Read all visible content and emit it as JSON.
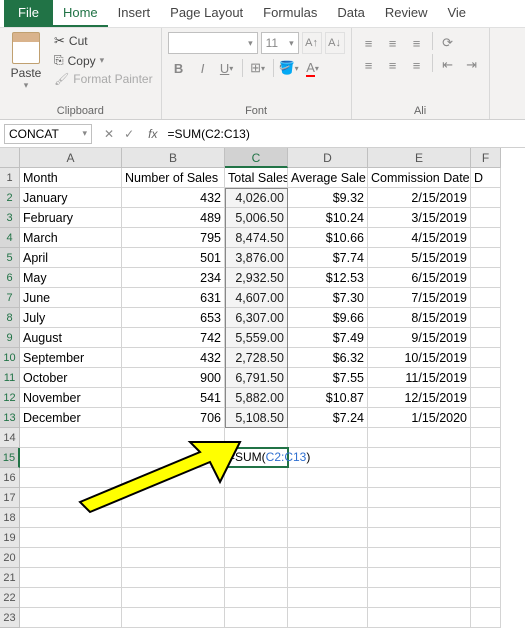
{
  "tabs": [
    "File",
    "Home",
    "Insert",
    "Page Layout",
    "Formulas",
    "Data",
    "Review",
    "Vie"
  ],
  "active_tab": "Home",
  "clipboard": {
    "paste": "Paste",
    "cut": "Cut",
    "copy": "Copy",
    "painter": "Format Painter",
    "label": "Clipboard"
  },
  "font": {
    "name": "",
    "size": "11",
    "label": "Font"
  },
  "align": {
    "label": "Ali"
  },
  "name_box": "CONCAT",
  "formula": "=SUM(C2:C13)",
  "columns": [
    "A",
    "B",
    "C",
    "D",
    "E",
    "F"
  ],
  "headers": [
    "Month",
    "Number of Sales",
    "Total Sales",
    "Average Sale",
    "Commission Date",
    "D"
  ],
  "rows": [
    {
      "month": "January",
      "sales": "432",
      "total": "4,026.00",
      "avg": "$9.32",
      "date": "2/15/2019"
    },
    {
      "month": "February",
      "sales": "489",
      "total": "5,006.50",
      "avg": "$10.24",
      "date": "3/15/2019"
    },
    {
      "month": "March",
      "sales": "795",
      "total": "8,474.50",
      "avg": "$10.66",
      "date": "4/15/2019"
    },
    {
      "month": "April",
      "sales": "501",
      "total": "3,876.00",
      "avg": "$7.74",
      "date": "5/15/2019"
    },
    {
      "month": "May",
      "sales": "234",
      "total": "2,932.50",
      "avg": "$12.53",
      "date": "6/15/2019"
    },
    {
      "month": "June",
      "sales": "631",
      "total": "4,607.00",
      "avg": "$7.30",
      "date": "7/15/2019"
    },
    {
      "month": "July",
      "sales": "653",
      "total": "6,307.00",
      "avg": "$9.66",
      "date": "8/15/2019"
    },
    {
      "month": "August",
      "sales": "742",
      "total": "5,559.00",
      "avg": "$7.49",
      "date": "9/15/2019"
    },
    {
      "month": "September",
      "sales": "432",
      "total": "2,728.50",
      "avg": "$6.32",
      "date": "10/15/2019"
    },
    {
      "month": "October",
      "sales": "900",
      "total": "6,791.50",
      "avg": "$7.55",
      "date": "11/15/2019"
    },
    {
      "month": "November",
      "sales": "541",
      "total": "5,882.00",
      "avg": "$10.87",
      "date": "12/15/2019"
    },
    {
      "month": "December",
      "sales": "706",
      "total": "5,108.50",
      "avg": "$7.24",
      "date": "1/15/2020"
    }
  ],
  "active_formula": {
    "prefix": "=SUM(",
    "ref": "C2:C13",
    "suffix": ")"
  }
}
